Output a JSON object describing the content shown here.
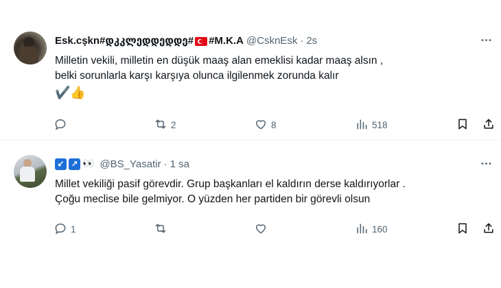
{
  "tweets": [
    {
      "display_name_a": "Esk.cşkn#დკკლედდედდე#",
      "display_name_b": "#M.K.A",
      "handle": "@CsknEsk",
      "separator": "·",
      "time": "2s",
      "text_lines": [
        "Milletin vekili, milletin en düşük maaş alan emeklisi kadar maaş alsın ,",
        "belki sorunlarla karşı karşıya olunca ilgilenmek zorunda kalır"
      ],
      "emoji_line": "✔️👍",
      "reply_count": "",
      "retweet_count": "2",
      "like_count": "8",
      "view_count": "518"
    },
    {
      "badge_a": "↙",
      "badge_b": "↗",
      "eyes": "👀",
      "handle": "@BS_Yasatir",
      "separator": "·",
      "time": "1 sa",
      "text_lines": [
        "Millet vekiliği pasif görevdir. Grup başkanları el kaldırın derse kaldırıyorlar .",
        "Çoğu meclise bile gelmiyor. O yüzden her partiden bir görevli olsun"
      ],
      "reply_count": "1",
      "retweet_count": "",
      "like_count": "",
      "view_count": "160"
    }
  ],
  "colors": {
    "text": "#0f1419",
    "muted": "#536471",
    "divider": "#eff3f4",
    "badge": "#1d6fd8"
  },
  "icons": [
    "more-icon",
    "reply-icon",
    "retweet-icon",
    "like-icon",
    "views-icon",
    "bookmark-icon",
    "share-icon"
  ]
}
